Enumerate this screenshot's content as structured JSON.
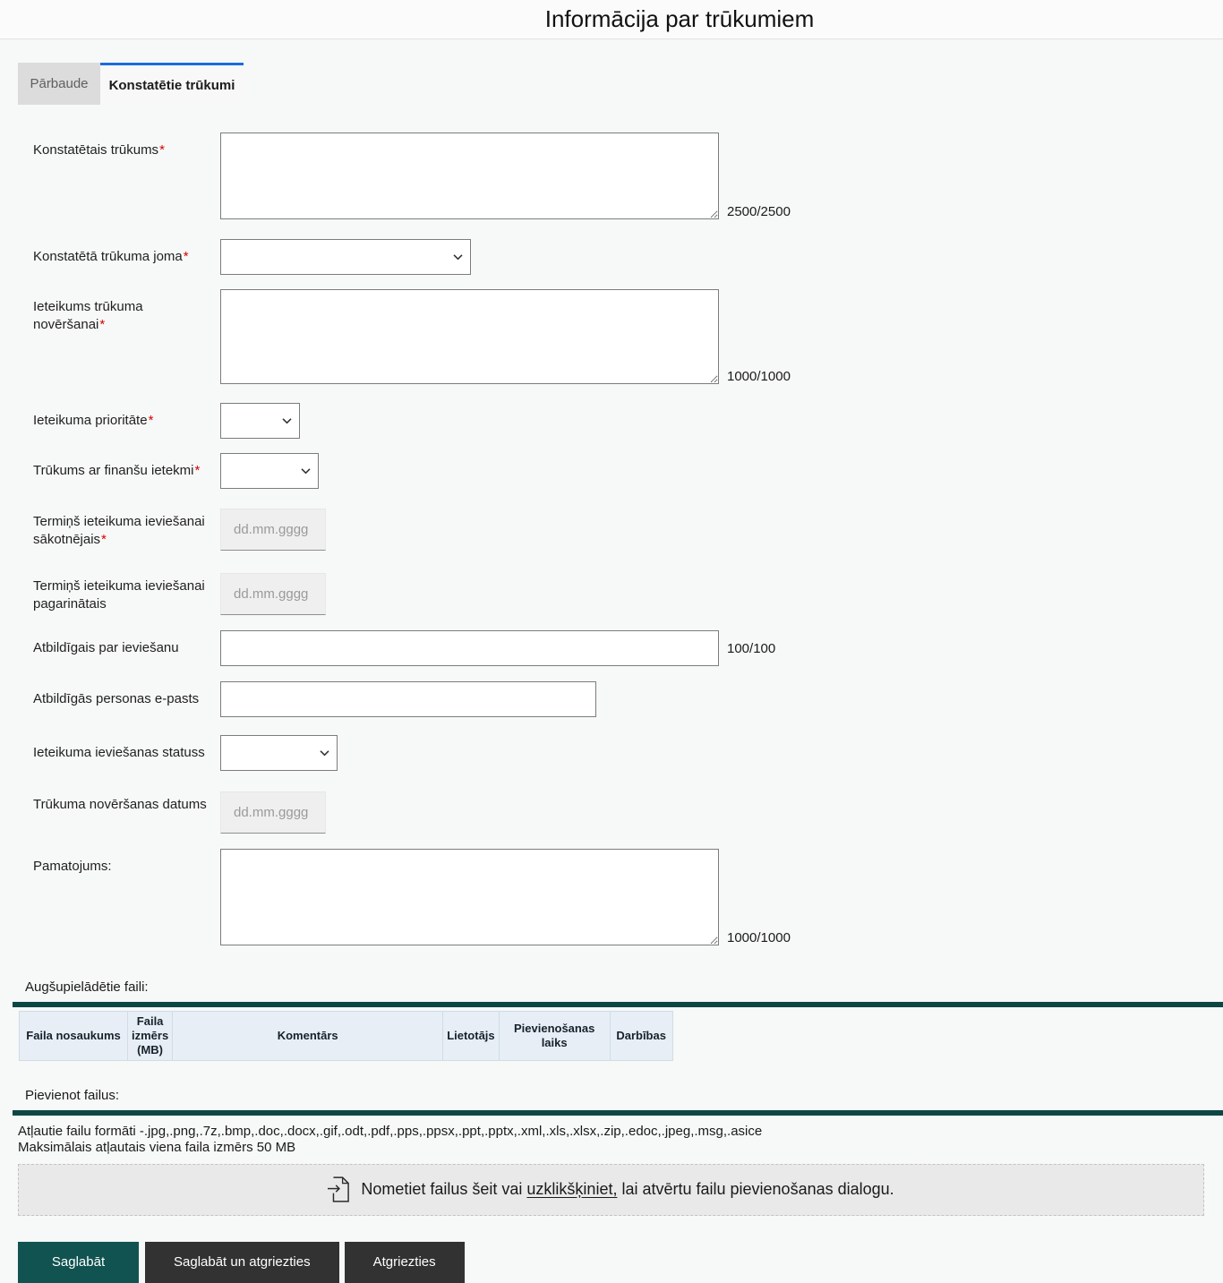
{
  "header": {
    "title": "Informācija par trūkumiem"
  },
  "tabs": [
    {
      "label": "Pārbaude",
      "active": false
    },
    {
      "label": "Konstatētie trūkumi",
      "active": true
    }
  ],
  "form": {
    "fields": [
      {
        "label": "Konstatētais trūkums",
        "required_mark": "*",
        "type": "textarea",
        "value": "",
        "counter": "2500/2500"
      },
      {
        "label": "Konstatētā trūkuma joma",
        "required_mark": "*",
        "type": "select",
        "value": ""
      },
      {
        "label": "Ieteikums trūkuma novēršanai",
        "required_mark": "*",
        "type": "textarea",
        "value": "",
        "counter": "1000/1000"
      },
      {
        "label": "Ieteikuma prioritāte",
        "required_mark": "*",
        "type": "select",
        "value": ""
      },
      {
        "label": "Trūkums ar finanšu ietekmi",
        "required_mark": "*",
        "type": "select",
        "value": ""
      },
      {
        "label": "Termiņš ieteikuma ieviešanai sākotnējais",
        "required_mark": "*",
        "type": "date",
        "value": "",
        "placeholder": "dd.mm.gggg"
      },
      {
        "label": "Termiņš ieteikuma ieviešanai pagarinātais",
        "required_mark": "",
        "type": "date",
        "value": "",
        "placeholder": "dd.mm.gggg"
      },
      {
        "label": "Atbildīgais par ieviešanu",
        "required_mark": "",
        "type": "text",
        "value": "",
        "counter": "100/100"
      },
      {
        "label": "Atbildīgās personas e-pasts",
        "required_mark": "",
        "type": "text",
        "value": ""
      },
      {
        "label": "Ieteikuma ieviešanas statuss",
        "required_mark": "",
        "type": "select",
        "value": ""
      },
      {
        "label": "Trūkuma novēršanas datums",
        "required_mark": "",
        "type": "date",
        "value": "",
        "placeholder": "dd.mm.gggg"
      },
      {
        "label": "Pamatojums:",
        "required_mark": "",
        "type": "textarea",
        "value": "",
        "counter": "1000/1000"
      }
    ]
  },
  "uploaded_files": {
    "section_label": "Augšupielādētie faili:",
    "columns": [
      "Faila nosaukums",
      "Faila izmērs (MB)",
      "Komentārs",
      "Lietotājs",
      "Pievienošanas laiks",
      "Darbības"
    ],
    "rows": []
  },
  "add_files": {
    "section_label": "Pievienot failus:",
    "formats_line": "Atļautie failu formāti -.jpg,.png,.7z,.bmp,.doc,.docx,.gif,.odt,.pdf,.pps,.ppsx,.ppt,.pptx,.xml,.xls,.xlsx,.zip,.edoc,.jpeg,.msg,.asice",
    "max_size_line": "Maksimālais atļautais viena faila izmērs 50 MB",
    "dropzone": {
      "icon": "import-file-icon",
      "text_before": "Nometiet failus šeit vai ",
      "link_text": "uzklikšķiniet,",
      "text_after": " lai atvērtu failu pievienošanas dialogu."
    }
  },
  "buttons": [
    {
      "label": "Saglabāt"
    },
    {
      "label": "Saglabāt un atgriezties"
    },
    {
      "label": "Atgriezties"
    }
  ],
  "colors": {
    "accent_divider_teal": "#0d4744",
    "primary_button_teal": "#115350",
    "secondary_button_dark": "#323232",
    "active_tab_indicator_blue": "#1b6ce0",
    "required_asterisk_red": "#d80000",
    "table_header_bg": "#e7eef5",
    "dropzone_bg": "#e9e9e9"
  }
}
